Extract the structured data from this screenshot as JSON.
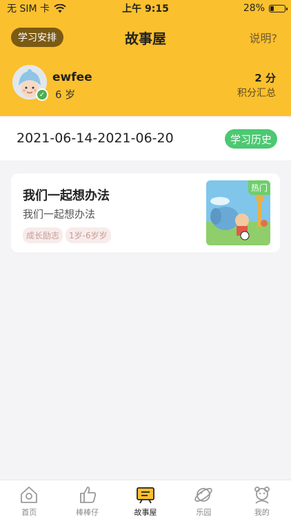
{
  "status": {
    "carrier": "无 SIM 卡",
    "time": "上午 9:15",
    "battery": "28%",
    "battery_level": 0.28
  },
  "nav": {
    "left_button": "学习安排",
    "title": "故事屋",
    "right_link": "说明?"
  },
  "profile": {
    "name": "ewfee",
    "age": "6 岁",
    "score_value": "2 分",
    "score_label": "积分汇总"
  },
  "week": {
    "range": "2021-06-14-2021-06-20",
    "history_button": "学习历史"
  },
  "stories": [
    {
      "title": "我们一起想办法",
      "subtitle": "我们一起想办法",
      "tags": [
        "成长励志",
        "1岁-6岁岁"
      ],
      "badge": "热门"
    }
  ],
  "tabs": [
    {
      "label": "首页",
      "icon": "home-icon"
    },
    {
      "label": "棒棒仔",
      "icon": "thumbs-up-icon"
    },
    {
      "label": "故事屋",
      "icon": "story-house-icon",
      "active": true
    },
    {
      "label": "乐园",
      "icon": "planet-icon"
    },
    {
      "label": "我的",
      "icon": "profile-icon"
    }
  ],
  "colors": {
    "header_yellow": "#fbc02d",
    "plan_button": "#7b5a14",
    "history_green": "#4cc872",
    "hot_badge": "#6dcf6a"
  }
}
